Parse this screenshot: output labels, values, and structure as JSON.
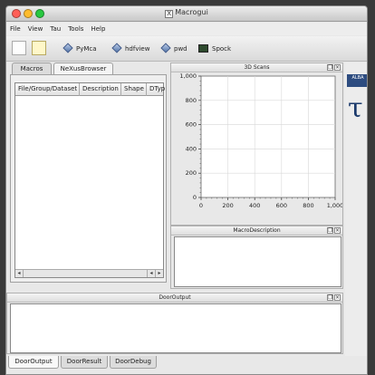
{
  "window": {
    "title": "Macrogui",
    "app_icon": "X",
    "traffic_lights": [
      "#ff5f57",
      "#febc2e",
      "#28c840"
    ]
  },
  "menu": [
    "File",
    "View",
    "Tau",
    "Tools",
    "Help"
  ],
  "toolbar": {
    "icons": [
      "new-file-icon",
      "folder-icon"
    ],
    "buttons": [
      {
        "label": "PyMca",
        "icon": "diamond-icon"
      },
      {
        "label": "hdfview",
        "icon": "diamond-icon"
      },
      {
        "label": "pwd",
        "icon": "diamond-icon"
      },
      {
        "label": "Spock",
        "icon": "terminal-icon"
      }
    ]
  },
  "left_tabs": [
    {
      "label": "Macros",
      "active": false
    },
    {
      "label": "NeXusBrowser",
      "active": true
    }
  ],
  "nexus_table": {
    "columns": [
      "File/Group/Dataset",
      "Description",
      "Shape",
      "DTyp"
    ]
  },
  "scans": {
    "title": "3D Scans",
    "dock_buttons": [
      "❐",
      "×"
    ]
  },
  "chart_data": {
    "type": "line",
    "title": "",
    "xlim": [
      0,
      1000
    ],
    "ylim": [
      0,
      1000
    ],
    "x_ticks": [
      "0",
      "200",
      "400",
      "600",
      "800",
      "1,000"
    ],
    "y_ticks": [
      "0",
      "200",
      "400",
      "600",
      "800",
      "1,000"
    ],
    "grid": true,
    "series": []
  },
  "macro_description": {
    "title": "MacroDescription",
    "dock_buttons": [
      "❐",
      "×"
    ]
  },
  "door_output": {
    "title": "DoorOutput",
    "dock_buttons": [
      "❐",
      "×"
    ]
  },
  "bottom_tabs": [
    {
      "label": "DoorOutput",
      "active": true
    },
    {
      "label": "DoorResult",
      "active": false
    },
    {
      "label": "DoorDebug",
      "active": false
    }
  ],
  "logos": {
    "alba": "ALBA",
    "tau": "τ"
  },
  "accent": "#1b3a6c"
}
